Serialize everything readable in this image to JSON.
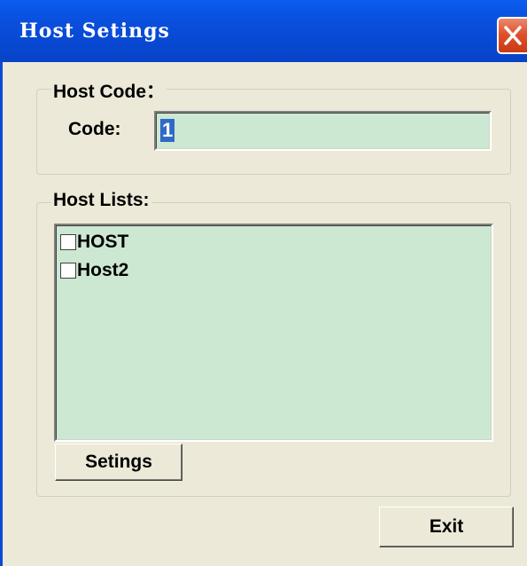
{
  "window": {
    "title": "Host Setings",
    "close_icon": "close-x-icon"
  },
  "host_code": {
    "group_label": "Host Code：",
    "code_label": "Code:",
    "code_value": "1"
  },
  "host_lists": {
    "group_label": "Host Lists:",
    "items": [
      {
        "label": "HOST",
        "checked": false
      },
      {
        "label": "Host2",
        "checked": false
      }
    ],
    "settings_button": "Setings"
  },
  "footer": {
    "exit_button": "Exit"
  },
  "colors": {
    "titlebar": "#0a4fdc",
    "window_bg": "#ece9d8",
    "field_bg": "#cce8d2",
    "selection": "#316ac5",
    "close_button": "#e0522b"
  }
}
